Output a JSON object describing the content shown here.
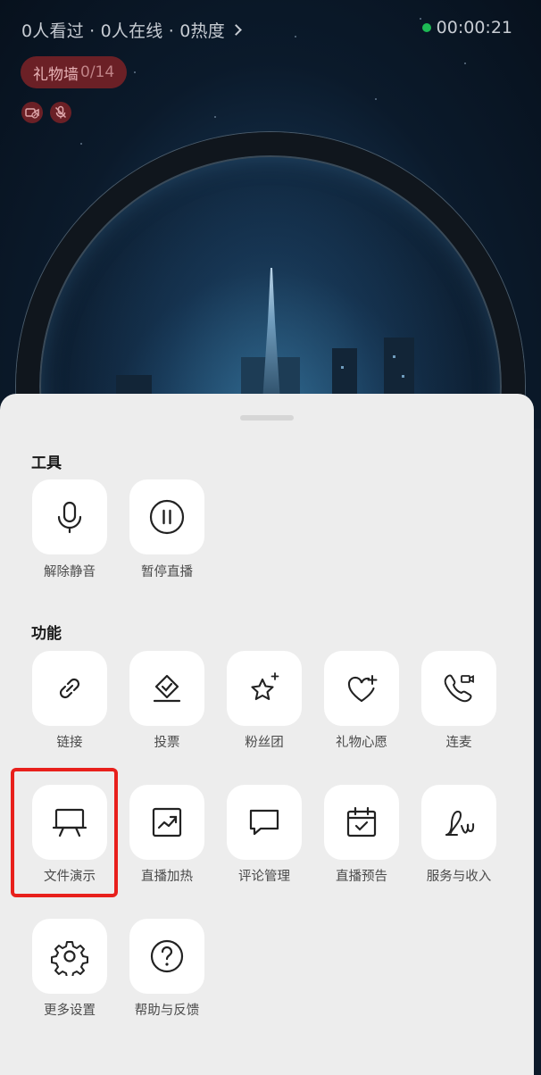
{
  "status_bar": {
    "stats": "0人看过 · 0人在线 · 0热度",
    "timer": "00:00:21",
    "live_dot_color": "#1db954"
  },
  "gift_wall": {
    "label": "礼物墙",
    "count": "0/14"
  },
  "mini_icons": [
    "camera-off-icon",
    "mic-off-icon"
  ],
  "sheet": {
    "tools_title": "工具",
    "features_title": "功能",
    "tools": [
      {
        "label": "解除静音",
        "icon": "microphone-icon"
      },
      {
        "label": "暂停直播",
        "icon": "pause-circle-icon"
      }
    ],
    "features": [
      {
        "label": "链接",
        "icon": "link-icon"
      },
      {
        "label": "投票",
        "icon": "vote-icon"
      },
      {
        "label": "粉丝团",
        "icon": "star-sparkle-icon"
      },
      {
        "label": "礼物心愿",
        "icon": "heart-sparkle-icon"
      },
      {
        "label": "连麦",
        "icon": "phone-video-icon"
      },
      {
        "label": "文件演示",
        "icon": "presentation-board-icon"
      },
      {
        "label": "直播加热",
        "icon": "trend-up-icon"
      },
      {
        "label": "评论管理",
        "icon": "comment-icon"
      },
      {
        "label": "直播预告",
        "icon": "calendar-check-icon"
      },
      {
        "label": "服务与收入",
        "icon": "signature-icon"
      },
      {
        "label": "更多设置",
        "icon": "gear-icon"
      },
      {
        "label": "帮助与反馈",
        "icon": "help-circle-icon"
      }
    ],
    "highlight_color": "#e8201c"
  }
}
